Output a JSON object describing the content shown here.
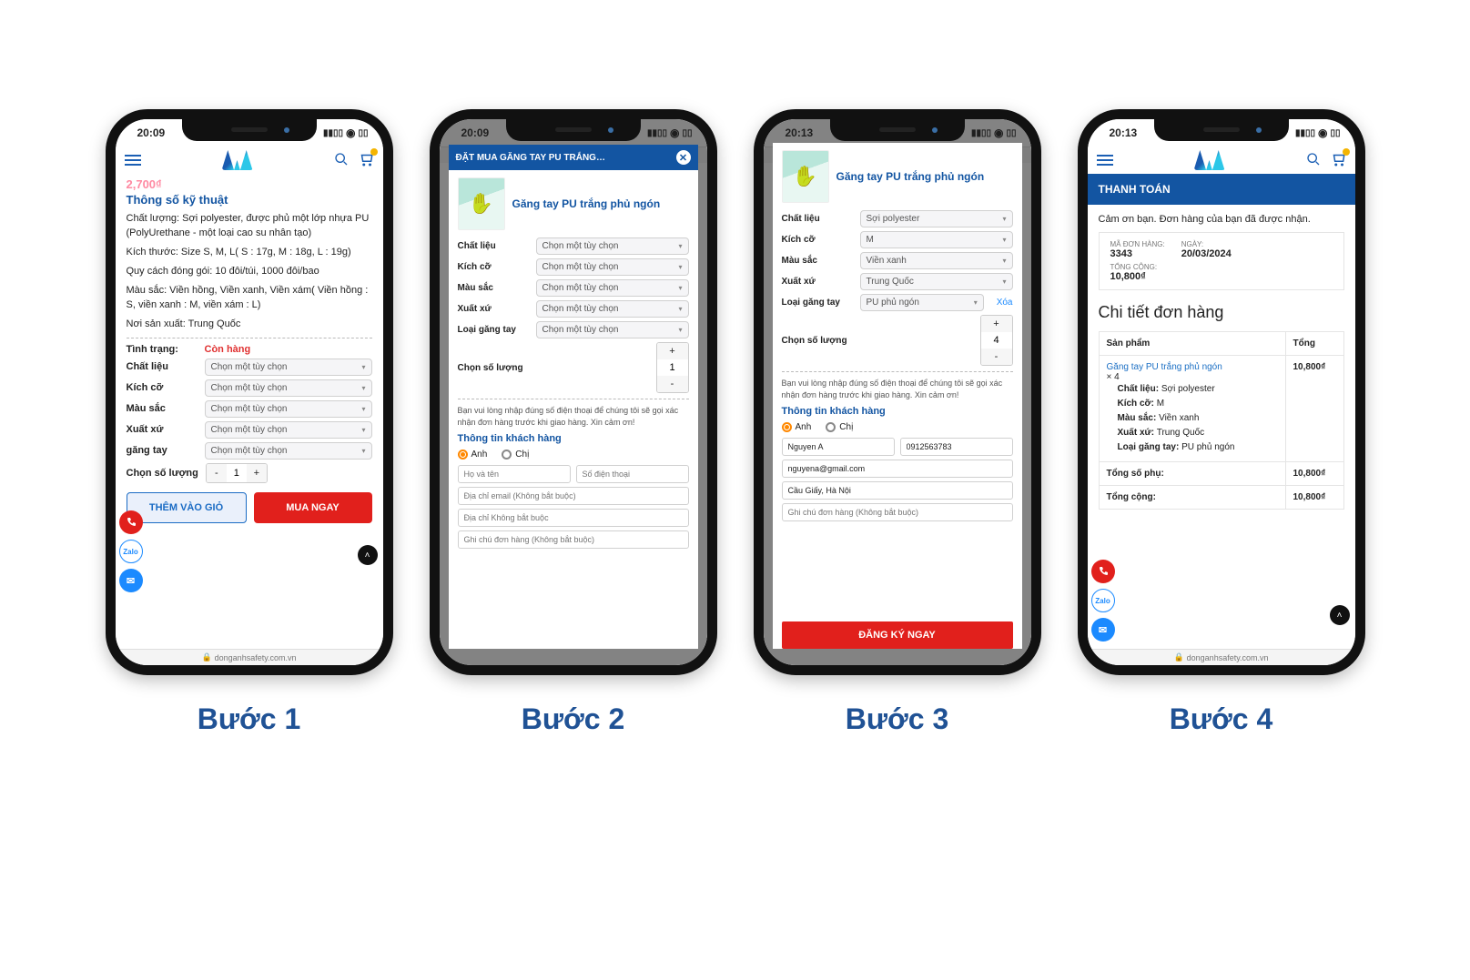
{
  "site_url": "donganhsafety.com.vn",
  "captions": [
    "Bước 1",
    "Bước 2",
    "Bước 3",
    "Bước 4"
  ],
  "status_times": [
    "20:09",
    "20:09",
    "20:13",
    "20:13"
  ],
  "product_name": "Găng tay PU trắng phủ ngón",
  "step1": {
    "price_ghost": "2,700₫",
    "title": "Thông số kỹ thuật",
    "specs": [
      "Chất lượng: Sợi polyester, được phủ một lớp nhựa PU (PolyUrethane - một loại cao su nhân tạo)",
      "Kích thước: Size S, M, L( S : 17g,  M : 18g,  L : 19g)",
      "Quy cách đóng gói: 10 đôi/túi, 1000 đôi/bao",
      "Màu sắc: Viền hồng, Viền xanh, Viền xám( Viền hồng : S, viền xanh : M, viền xám : L)",
      "Nơi sản xuất: Trung Quốc"
    ],
    "stock_label": "Tình trạng:",
    "stock_value": "Còn hàng",
    "select_labels": [
      "Chất liệu",
      "Kích cỡ",
      "Màu sắc",
      "Xuất xứ",
      "găng tay"
    ],
    "select_placeholder": "Chọn một tùy chọn",
    "qty_label": "Chọn số lượng",
    "qty_value": "1",
    "btn_add": "THÊM VÀO GIỎ",
    "btn_buy": "MUA NGAY"
  },
  "step2": {
    "modal_title": "ĐẶT MUA GĂNG TAY PU TRẮNG…",
    "select_labels": [
      "Chất liệu",
      "Kích cỡ",
      "Màu sắc",
      "Xuất xứ",
      "Loại găng tay"
    ],
    "select_placeholder": "Chọn một tùy chọn",
    "qty_label": "Chọn số lượng",
    "qty_value": "1",
    "note": "Bạn vui lòng nhập đúng số điện thoại để chúng tôi sẽ gọi xác nhận đơn hàng trước khi giao hàng. Xin cảm ơn!",
    "cust_header": "Thông tin khách hàng",
    "radio": [
      "Anh",
      "Chị"
    ],
    "placeholders": {
      "name": "Họ và tên",
      "phone": "Số điện thoại",
      "email": "Địa chỉ email (Không bắt buộc)",
      "addr": "Địa chỉ Không bắt buộc",
      "note": "Ghi chú đơn hàng (Không bắt buộc)"
    }
  },
  "step3": {
    "product_name": "Găng tay PU trắng phủ ngón",
    "opts": [
      {
        "label": "Chất liệu",
        "value": "Sợi polyester"
      },
      {
        "label": "Kích cỡ",
        "value": "M"
      },
      {
        "label": "Màu sắc",
        "value": "Viền xanh"
      },
      {
        "label": "Xuất xứ",
        "value": "Trung Quốc"
      },
      {
        "label": "Loại găng tay",
        "value": "PU phủ ngón"
      }
    ],
    "clear": "Xóa",
    "qty_label": "Chọn số lượng",
    "qty_value": "4",
    "note": "Bạn vui lòng nhập đúng số điện thoại để chúng tôi sẽ gọi xác nhận đơn hàng trước khi giao hàng. Xin cảm ơn!",
    "cust_header": "Thông tin khách hàng",
    "radio": [
      "Anh",
      "Chị"
    ],
    "fields": {
      "name": "Nguyen A",
      "phone": "0912563783",
      "email": "nguyena@gmail.com",
      "addr": "Cầu Giấy, Hà Nội",
      "note": "Ghi chú đơn hàng (Không bắt buộc)"
    },
    "submit": "ĐĂNG KÝ NGAY"
  },
  "step4": {
    "title": "THANH TOÁN",
    "thanks": "Cảm ơn bạn. Đơn hàng của bạn đã được nhận.",
    "meta": [
      {
        "label": "MÃ ĐƠN HÀNG:",
        "value": "3343"
      },
      {
        "label": "NGÀY:",
        "value": "20/03/2024"
      },
      {
        "label": "TỔNG CỘNG:",
        "value": "10,800₫"
      }
    ],
    "detail_header": "Chi tiết đơn hàng",
    "th": [
      "Sản phẩm",
      "Tổng"
    ],
    "item_name": "Găng tay PU trắng phủ ngón",
    "item_mult": "× 4",
    "attrs": [
      {
        "k": "Chất liệu:",
        "v": "Sợi polyester"
      },
      {
        "k": "Kích cỡ:",
        "v": "M"
      },
      {
        "k": "Màu sắc:",
        "v": "Viền xanh"
      },
      {
        "k": "Xuất xứ:",
        "v": "Trung Quốc"
      },
      {
        "k": "Loại găng tay:",
        "v": "PU phủ ngón"
      }
    ],
    "line_total": "10,800₫",
    "rows": [
      {
        "l": "Tổng số phụ:",
        "r": "10,800₫"
      },
      {
        "l": "Tổng cộng:",
        "r": "10,800₫"
      }
    ]
  }
}
